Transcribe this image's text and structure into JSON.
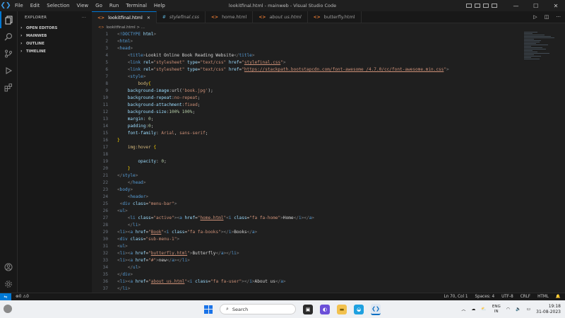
{
  "titlebar": {
    "menu": [
      "File",
      "Edit",
      "Selection",
      "View",
      "Go",
      "Run",
      "Terminal",
      "Help"
    ],
    "title": "lookitfinal.html - mainweb - Visual Studio Code"
  },
  "activity_icons": [
    "files-icon",
    "search-icon",
    "source-control-icon",
    "run-debug-icon",
    "extensions-icon"
  ],
  "sidebar": {
    "header": "EXPLORER",
    "more": "···",
    "sections": [
      "OPEN EDITORS",
      "MAINWEB",
      "OUTLINE",
      "TIMELINE"
    ]
  },
  "tabs": [
    {
      "icon": "<>",
      "label": "lookitfinal.html",
      "active": true
    },
    {
      "icon": "#",
      "label": "stylefinal.css",
      "active": false
    },
    {
      "icon": "<>",
      "label": "home.html",
      "active": false
    },
    {
      "icon": "<>",
      "label": "about us.html",
      "active": false
    },
    {
      "icon": "<>",
      "label": "butterfly.html",
      "active": false
    }
  ],
  "breadcrumb": "lookitfinal.html > ...",
  "editor": {
    "start_line": 1
  },
  "statusbar": {
    "problems": "⊗0 ⚠0",
    "warn": "⚠0",
    "position": "Ln 70, Col 1",
    "spaces": "Spaces: 4",
    "encoding": "UTF-8",
    "eol": "CRLF",
    "language": "HTML"
  },
  "taskbar": {
    "search": "Search",
    "lang_top": "ENG",
    "lang_bottom": "IN",
    "time": "19:18",
    "date": "31-08-2023"
  }
}
